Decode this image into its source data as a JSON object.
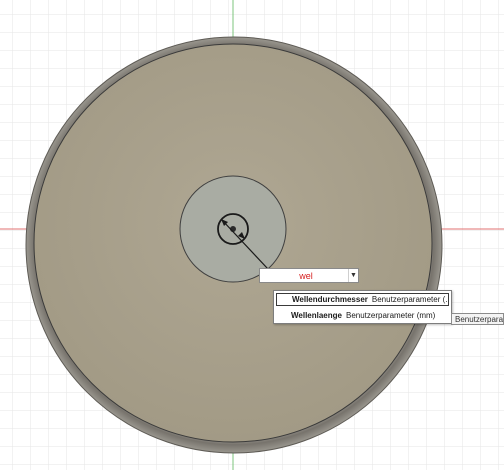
{
  "dimension_input": {
    "value": "wel",
    "dropdown_icon": "triangle-down"
  },
  "suggestions": [
    {
      "name": "Wellendurchmesser",
      "desc": "Benutzerparameter (...",
      "selected": true
    },
    {
      "name": "Wellenlaenge",
      "desc": "Benutzerparameter (mm)",
      "selected": false
    }
  ],
  "tooltip": {
    "text": "Benutzerparam"
  },
  "colors": {
    "grid": "#e4e4e4",
    "x_axis": "#e07070",
    "y_axis": "#7cc47c",
    "disk_face": "#a79f8c",
    "disk_rim": "#8c8a86",
    "hub": "#a9aca3",
    "input_text": "#d62020"
  }
}
